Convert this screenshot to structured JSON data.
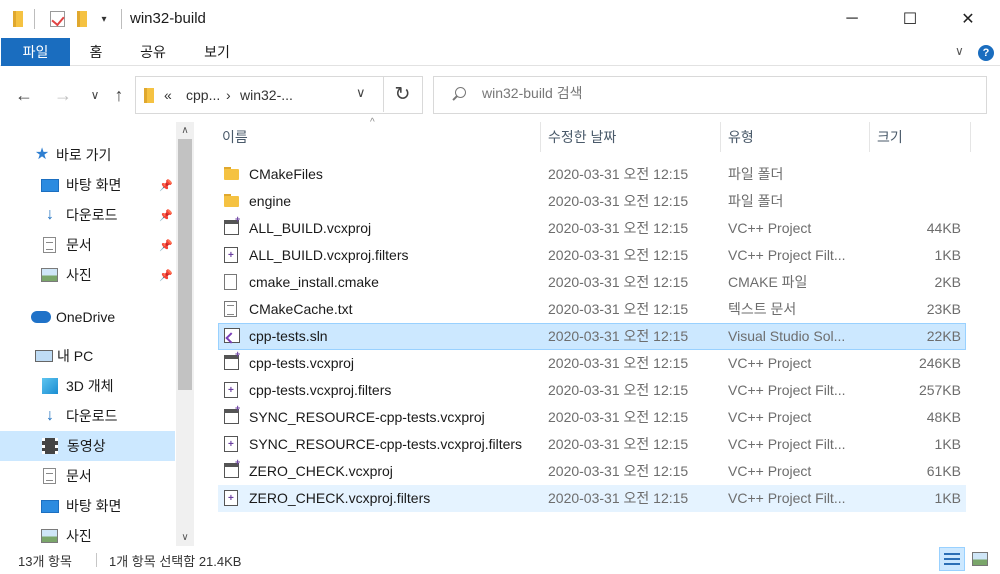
{
  "window": {
    "title": "win32-build",
    "min_label": "─",
    "max_label": "☐",
    "close_label": "✕"
  },
  "ribbon": {
    "tabs": [
      "파일",
      "홈",
      "공유",
      "보기"
    ],
    "expand_label": "∨",
    "help_label": "?"
  },
  "nav": {
    "back_label": "←",
    "forward_label": "→",
    "recent_label": "∨",
    "up_label": "↑",
    "refresh_label": "↻",
    "address": {
      "overflow": "«",
      "crumbs": [
        "cpp...",
        "win32-..."
      ],
      "sep": "›",
      "dropdown_label": "∨"
    },
    "search_placeholder": "win32-build 검색"
  },
  "sidebar": {
    "items": [
      {
        "label": "바로 가기",
        "icon": "star-icon",
        "pinned": false
      },
      {
        "label": "바탕 화면",
        "icon": "desktop-icon",
        "pinned": true
      },
      {
        "label": "다운로드",
        "icon": "download-icon",
        "pinned": true
      },
      {
        "label": "문서",
        "icon": "document-icon",
        "pinned": true
      },
      {
        "label": "사진",
        "icon": "pictures-icon",
        "pinned": true
      },
      {
        "label": "OneDrive",
        "icon": "onedrive-icon",
        "pinned": false
      },
      {
        "label": "내 PC",
        "icon": "pc-icon",
        "pinned": false
      },
      {
        "label": "3D 개체",
        "icon": "3d-objects-icon",
        "pinned": false
      },
      {
        "label": "다운로드",
        "icon": "download-icon",
        "pinned": false
      },
      {
        "label": "동영상",
        "icon": "videos-icon",
        "pinned": false,
        "selected": true
      },
      {
        "label": "문서",
        "icon": "document-icon",
        "pinned": false
      },
      {
        "label": "바탕 화면",
        "icon": "desktop-icon",
        "pinned": false
      },
      {
        "label": "사진",
        "icon": "pictures-icon",
        "pinned": false
      }
    ],
    "pin_label": "📌",
    "scroll_up": "∧",
    "scroll_down": "∨"
  },
  "columns": {
    "name": "이름",
    "date": "수정한 날짜",
    "type": "유형",
    "size": "크기",
    "sort_caret": "^"
  },
  "files": [
    {
      "name": "CMakeFiles",
      "date": "2020-03-31 오전 12:15",
      "type": "파일 폴더",
      "size": "",
      "icon": "folder-icon"
    },
    {
      "name": "engine",
      "date": "2020-03-31 오전 12:15",
      "type": "파일 폴더",
      "size": "",
      "icon": "folder-icon"
    },
    {
      "name": "ALL_BUILD.vcxproj",
      "date": "2020-03-31 오전 12:15",
      "type": "VC++ Project",
      "size": "44KB",
      "icon": "vcxproj-icon"
    },
    {
      "name": "ALL_BUILD.vcxproj.filters",
      "date": "2020-03-31 오전 12:15",
      "type": "VC++ Project Filt...",
      "size": "1KB",
      "icon": "vcxproj-filters-icon"
    },
    {
      "name": "cmake_install.cmake",
      "date": "2020-03-31 오전 12:15",
      "type": "CMAKE 파일",
      "size": "2KB",
      "icon": "blank-file-icon"
    },
    {
      "name": "CMakeCache.txt",
      "date": "2020-03-31 오전 12:15",
      "type": "텍스트 문서",
      "size": "23KB",
      "icon": "text-file-icon"
    },
    {
      "name": "cpp-tests.sln",
      "date": "2020-03-31 오전 12:15",
      "type": "Visual Studio Sol...",
      "size": "22KB",
      "icon": "sln-icon",
      "state": "selected"
    },
    {
      "name": "cpp-tests.vcxproj",
      "date": "2020-03-31 오전 12:15",
      "type": "VC++ Project",
      "size": "246KB",
      "icon": "vcxproj-icon"
    },
    {
      "name": "cpp-tests.vcxproj.filters",
      "date": "2020-03-31 오전 12:15",
      "type": "VC++ Project Filt...",
      "size": "257KB",
      "icon": "vcxproj-filters-icon"
    },
    {
      "name": "SYNC_RESOURCE-cpp-tests.vcxproj",
      "date": "2020-03-31 오전 12:15",
      "type": "VC++ Project",
      "size": "48KB",
      "icon": "vcxproj-icon"
    },
    {
      "name": "SYNC_RESOURCE-cpp-tests.vcxproj.filters",
      "date": "2020-03-31 오전 12:15",
      "type": "VC++ Project Filt...",
      "size": "1KB",
      "icon": "vcxproj-filters-icon"
    },
    {
      "name": "ZERO_CHECK.vcxproj",
      "date": "2020-03-31 오전 12:15",
      "type": "VC++ Project",
      "size": "61KB",
      "icon": "vcxproj-icon"
    },
    {
      "name": "ZERO_CHECK.vcxproj.filters",
      "date": "2020-03-31 오전 12:15",
      "type": "VC++ Project Filt...",
      "size": "1KB",
      "icon": "vcxproj-filters-icon",
      "state": "hover"
    }
  ],
  "status": {
    "item_count": "13개 항목",
    "selection": "1개 항목 선택함 21.4KB"
  },
  "colors": {
    "accent": "#1a6dbf",
    "selection": "#cce8ff",
    "hover": "#e5f3ff"
  }
}
